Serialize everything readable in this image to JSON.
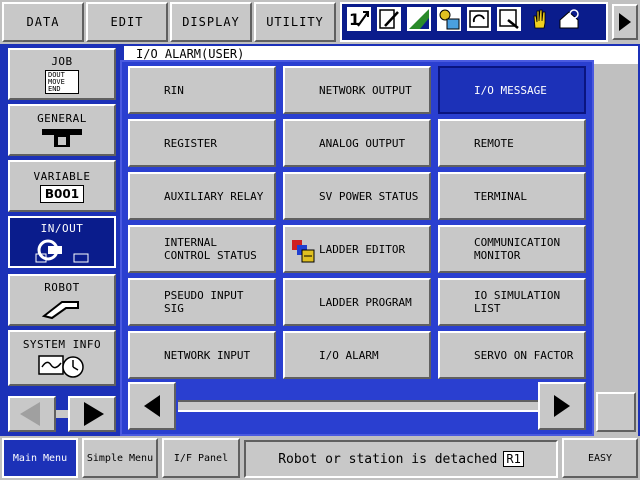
{
  "top_menu": [
    {
      "label": "DATA"
    },
    {
      "label": "EDIT"
    },
    {
      "label": "DISPLAY"
    },
    {
      "label": "UTILITY"
    }
  ],
  "status_icons": [
    "coordinate-icon",
    "edit-mode-icon",
    "speed-icon",
    "play-icon",
    "cycle-icon",
    "servo-icon",
    "hand-icon",
    "security-icon"
  ],
  "window_title": "I/O ALARM(USER)",
  "side_menu": {
    "job": {
      "label": "JOB",
      "icon_text": [
        "DOUT",
        "MOVE",
        "END"
      ]
    },
    "general": {
      "label": "GENERAL"
    },
    "variable": {
      "label": "VARIABLE",
      "badge": "B001"
    },
    "inout": {
      "label": "IN/OUT"
    },
    "robot": {
      "label": "ROBOT"
    },
    "system_info": {
      "label": "SYSTEM INFO"
    }
  },
  "submenu": {
    "items": [
      {
        "label": "RIN"
      },
      {
        "label": "NETWORK OUTPUT"
      },
      {
        "label": "I/O MESSAGE"
      },
      {
        "label": "REGISTER"
      },
      {
        "label": "ANALOG OUTPUT"
      },
      {
        "label": "REMOTE"
      },
      {
        "label": "AUXILIARY RELAY"
      },
      {
        "label": "SV POWER STATUS"
      },
      {
        "label": "TERMINAL"
      },
      {
        "label": "INTERNAL\nCONTROL STATUS"
      },
      {
        "label": "LADDER EDITOR"
      },
      {
        "label": "COMMUNICATION\nMONITOR"
      },
      {
        "label": "PSEUDO INPUT\nSIG"
      },
      {
        "label": "LADDER PROGRAM"
      },
      {
        "label": "IO SIMULATION\nLIST"
      },
      {
        "label": "NETWORK INPUT"
      },
      {
        "label": "I/O ALARM"
      },
      {
        "label": "SERVO ON FACTOR"
      }
    ]
  },
  "bottom_bar": {
    "main_menu": "Main Menu",
    "simple_menu": "Simple Menu",
    "if_panel": "I/F Panel",
    "message": "Robot or station is detached",
    "message_badge": "R1",
    "easy": "EASY"
  },
  "colors": {
    "accent": "#1c31b8",
    "panel_gray": "#c8c8c8",
    "selected": "#1c31b8"
  }
}
